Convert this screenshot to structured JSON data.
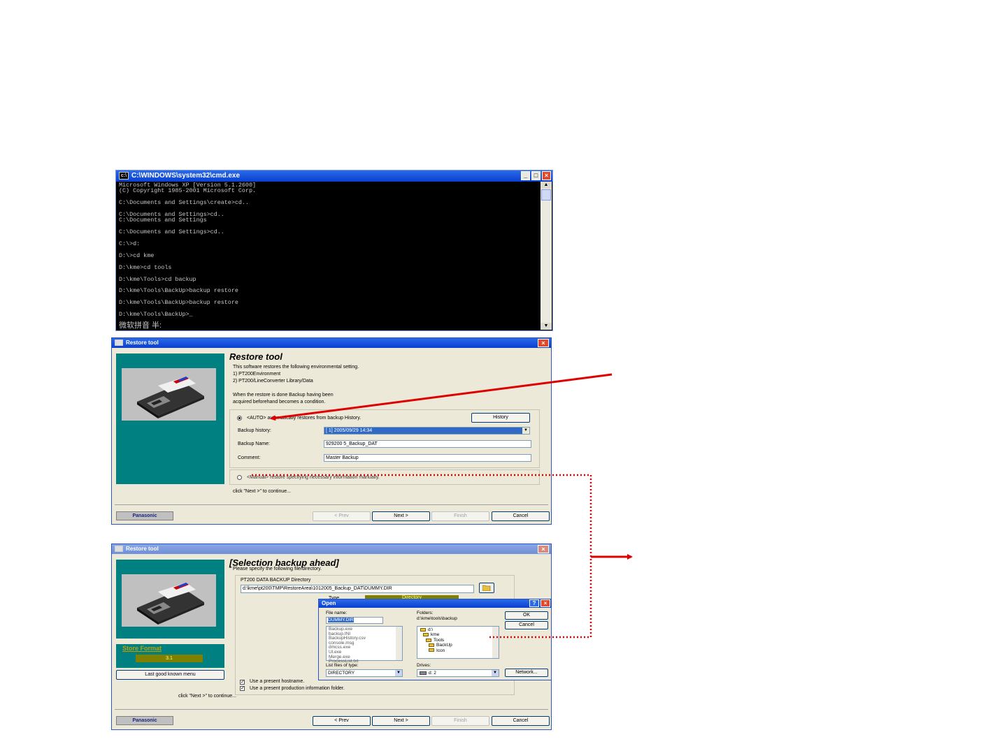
{
  "cmd": {
    "title": "C:\\WINDOWS\\system32\\cmd.exe",
    "icon": "cmd-icon",
    "lines": [
      "Microsoft Windows XP [Version 5.1.2600]",
      "(C) Copyright 1985-2001 Microsoft Corp.",
      "",
      "C:\\Documents and Settings\\create>cd..",
      "",
      "C:\\Documents and Settings>cd..",
      "C:\\Documents and Settings",
      "",
      "C:\\Documents and Settings>cd..",
      "",
      "C:\\>d:",
      "",
      "D:\\>cd kme",
      "",
      "D:\\kme>cd tools",
      "",
      "D:\\kme\\Tools>cd backup",
      "",
      "D:\\kme\\Tools\\BackUp>backup restore",
      "",
      "D:\\kme\\Tools\\BackUp>backup restore",
      "",
      "D:\\kme\\Tools\\BackUp>_"
    ],
    "ime": "微软拼音 半:",
    "min": "_",
    "max": "□",
    "close": "×"
  },
  "restore1": {
    "title": "Restore tool",
    "heading": "Restore tool",
    "desc": [
      "This software restores the following environmental setting.",
      "1) PT200Environment",
      "2) PT200/LineConverter Library/Data",
      "",
      "When the restore is done Backup having been",
      "acquired beforehand becomes a condition."
    ],
    "auto_label": "<AUTO> automatically restores from backup History.",
    "history_button": "History",
    "backup_history_label": "Backup history:",
    "backup_history_value": "[ 1] 2005/09/29 14:34",
    "backup_name_label": "Backup Name:",
    "backup_name_value": "929200 5_Backup_DAT",
    "comment_label": "Comment:",
    "comment_value": "Master Backup",
    "manual_label": "<Manual> restore specifying necessary information manually.",
    "hint": "click \"Next >\" to continue...",
    "brand": "Panasonic",
    "prev": "< Prev",
    "next": "Next >",
    "finish": "Finish",
    "cancel": "Cancel"
  },
  "restore2": {
    "title": "Restore tool",
    "heading": "[Selection backup ahead]",
    "subheading": "Please specify the following file/directory.",
    "dir_group_label": "PT200 DATA BACKUP Directory",
    "dir_value": "d:\\kme\\pt200\\TMP\\RestoreArea\\1012005_Backup_DAT\\DUMMY.DIR",
    "type_label": "Type",
    "type_value": "Directory",
    "store_format_label": "Store Format",
    "store_format_value": "3.1",
    "last_good_button": "Last good known menu",
    "check_hostname": "Use a present hostname.",
    "check_production": "Use a present production information folder.",
    "hint": "click \"Next >\" to continue...",
    "brand": "Panasonic",
    "prev": "< Prev",
    "next": "Next >",
    "finish": "Finish",
    "cancel": "Cancel"
  },
  "open_dialog": {
    "title": "Open",
    "help": "?",
    "close": "×",
    "filename_label": "File name:",
    "filename_value": "DUMMY.DIR",
    "folders_label": "Folders:",
    "folders_path": "d:\\kme\\tools\\backup",
    "files": [
      "Backup.exe",
      "backup.INI",
      "BackupHistory.csv",
      "console.msg",
      "dmcss.exe",
      "Ul.exe",
      "Merge.exe",
      "ProcessList.txt"
    ],
    "folder_tree": [
      "d:\\",
      "kme",
      "Tools",
      "BackUp",
      "Icon"
    ],
    "ok": "OK",
    "cancel": "Cancel",
    "list_type_label": "List files of type:",
    "list_type_value": "DIRECTORY",
    "drives_label": "Drives:",
    "drives_value": "d: 2",
    "network": "Network..."
  },
  "colors": {
    "title_blue": "#0a3fd0",
    "teal": "#008080",
    "annotation_red": "#e00000"
  }
}
